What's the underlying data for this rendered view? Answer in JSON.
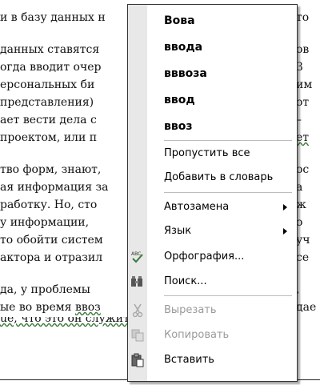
{
  "document": {
    "lines": [
      {
        "left": "и в базу данных н",
        "right": "то"
      },
      {
        "left": "",
        "right": ""
      },
      {
        "left": "данных ставятся",
        "right": "ов"
      },
      {
        "left": "огда вводит очер",
        "right": "З"
      },
      {
        "left": "ерсональных би",
        "right": "им"
      },
      {
        "left": "представления) ",
        "right": "от"
      },
      {
        "left": "ает вести дела с",
        "right": "–"
      },
      {
        "left": "проектом, или п",
        "right": "ет"
      },
      {
        "left": "",
        "right": ""
      },
      {
        "left": "тво форм, знают,",
        "right": "ос"
      },
      {
        "left": "ая информация за",
        "right": "а"
      },
      {
        "left": "работку. Но, сто",
        "right": "ж"
      },
      {
        "left": "у информации, ",
        "right": "о"
      },
      {
        "left": "то обойти систем",
        "right": "уч"
      },
      {
        "left": "актора и отразил",
        "right": "се"
      },
      {
        "left": "",
        "right": ""
      },
      {
        "left": "да, у проблемы",
        "right": ", "
      },
      {
        "left": "ые во время ",
        "right": "дае"
      },
      {
        "left": "ue, что это он служит программе, а не наобо",
        "right": ""
      }
    ],
    "misspelled_word": "ввоз"
  },
  "context_menu": {
    "suggestions": [
      "Вова",
      "ввода",
      "вввоза",
      "ввод",
      "ввоз"
    ],
    "items": [
      {
        "label": "Пропустить все",
        "icon": "",
        "enabled": true,
        "submenu": false
      },
      {
        "label": "Добавить в словарь",
        "icon": "",
        "enabled": true,
        "submenu": false
      },
      {
        "label": "Автозамена",
        "icon": "",
        "enabled": true,
        "submenu": true
      },
      {
        "label": "Язык",
        "icon": "",
        "enabled": true,
        "submenu": true
      },
      {
        "label": "Орфография...",
        "icon": "spellcheck-icon",
        "enabled": true,
        "submenu": false
      },
      {
        "label": "Поиск...",
        "icon": "research-icon",
        "enabled": true,
        "submenu": false
      },
      {
        "label": "Вырезать",
        "icon": "cut-icon",
        "enabled": false,
        "submenu": false
      },
      {
        "label": "Копировать",
        "icon": "copy-icon",
        "enabled": false,
        "submenu": false
      },
      {
        "label": "Вставить",
        "icon": "paste-icon",
        "enabled": true,
        "submenu": false
      }
    ]
  }
}
